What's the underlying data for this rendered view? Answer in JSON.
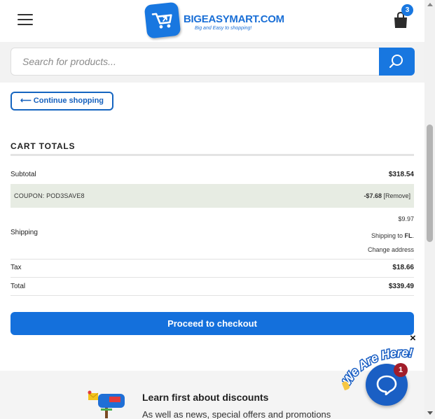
{
  "header": {
    "logo": {
      "name": "BIGEASYMART.COM",
      "tagline": "Big and Easy to shopping!"
    },
    "cart_count": "3",
    "colors": {
      "brand": "#1877e0"
    }
  },
  "search": {
    "placeholder": "Search for products..."
  },
  "continue_label": "⟵ Continue shopping",
  "cart_totals": {
    "title": "CART TOTALS",
    "subtotal_label": "Subtotal",
    "subtotal_value": "$318.54",
    "coupon_label": "COUPON: POD3SAVE8",
    "coupon_amount": "-$7.68",
    "coupon_remove": "[Remove]",
    "shipping_label": "Shipping",
    "shipping_value": "$9.97",
    "shipping_to_prefix": "Shipping to ",
    "shipping_to_state": "FL",
    "change_address": "Change address",
    "tax_label": "Tax",
    "tax_value": "$18.66",
    "total_label": "Total",
    "total_value": "$339.49"
  },
  "checkout_label": "Proceed to checkout",
  "newsletter": {
    "title": "Learn first about discounts",
    "subtitle": "As well as news, special offers and promotions"
  },
  "chat": {
    "banner_text": "We Are Here!",
    "unread_count": "1",
    "close_symbol": "×"
  }
}
